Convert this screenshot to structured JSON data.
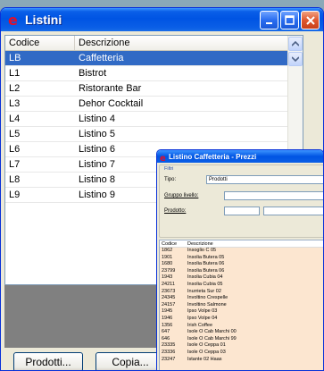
{
  "main_window": {
    "title": "Listini",
    "columns": [
      "Codice",
      "Descrizione"
    ],
    "rows": [
      {
        "code": "LB",
        "desc": "Caffetteria"
      },
      {
        "code": "L1",
        "desc": "Bistrot"
      },
      {
        "code": "L2",
        "desc": "Ristorante Bar"
      },
      {
        "code": "L3",
        "desc": "Dehor Cocktail"
      },
      {
        "code": "L4",
        "desc": "Listino 4"
      },
      {
        "code": "L5",
        "desc": "Listino 5"
      },
      {
        "code": "L6",
        "desc": "Listino 6"
      },
      {
        "code": "L7",
        "desc": "Listino 7"
      },
      {
        "code": "L8",
        "desc": "Listino 8"
      },
      {
        "code": "L9",
        "desc": "Listino 9"
      }
    ],
    "selected_row": 0,
    "buttons": {
      "prodotti": "Prodotti...",
      "copia": "Copia..."
    }
  },
  "popup": {
    "title": "Listino Caffetteria - Prezzi",
    "filters_label": "Filtri",
    "tipo_label": "Tipo:",
    "tipo_value": "Prodotti",
    "gruppo_label": "Gruppo livello:",
    "prodotto_label": "Prodotto:",
    "columns": [
      "Codice",
      "Descrizione"
    ],
    "rows": [
      {
        "code": "1862",
        "desc": "Insoglio C 05"
      },
      {
        "code": "1901",
        "desc": "Insolia Butera 05"
      },
      {
        "code": "1680",
        "desc": "Insolia Butera 06"
      },
      {
        "code": "23799",
        "desc": "Insolia Butera 06"
      },
      {
        "code": "1943",
        "desc": "Insolia Cubia 04"
      },
      {
        "code": "24211",
        "desc": "Insolia Cubia 05"
      },
      {
        "code": "23673",
        "desc": "Inurrieta Sur 02"
      },
      {
        "code": "24345",
        "desc": "Involtino Crespelle"
      },
      {
        "code": "24157",
        "desc": "Involtino Salmone"
      },
      {
        "code": "1945",
        "desc": "Ipso Volpe 03"
      },
      {
        "code": "1946",
        "desc": "Ipso Volpe 04"
      },
      {
        "code": "1356",
        "desc": "Irish Coffee"
      },
      {
        "code": "647",
        "desc": "Isole O Cab Marchi 00"
      },
      {
        "code": "646",
        "desc": "Isole O Cab Marchi 99"
      },
      {
        "code": "23335",
        "desc": "Isole O Ceppa 01"
      },
      {
        "code": "23336",
        "desc": "Isole O Ceppa 03"
      },
      {
        "code": "23247",
        "desc": "Istante 02 Haas"
      }
    ]
  },
  "colors": {
    "titlebar": "#0054e3",
    "selection": "#316ac5",
    "list_bg": "#fce6d0"
  }
}
